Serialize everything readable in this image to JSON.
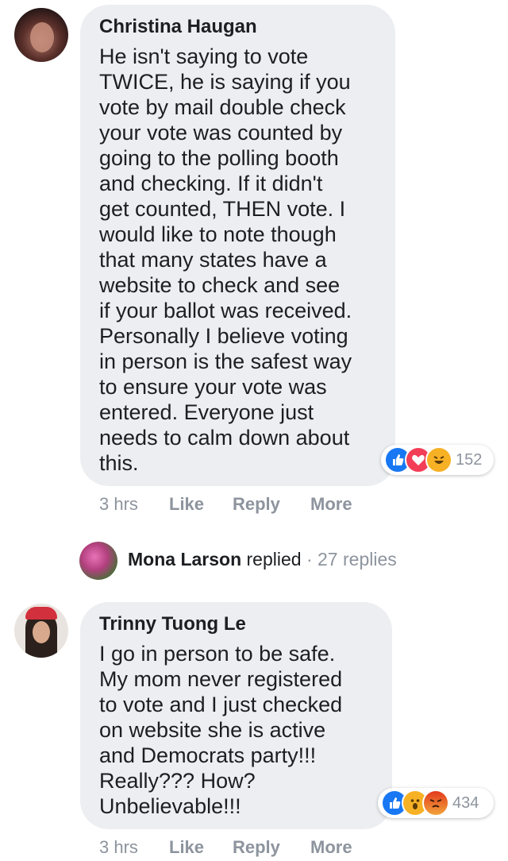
{
  "comments": [
    {
      "author": "Christina Haugan",
      "text": "He isn't saying to vote\nTWICE, he is saying if you\nvote by mail double check\nyour vote was counted by\ngoing to the polling booth\nand checking. If it didn't\nget counted, THEN vote. I\nwould like to note though\nthat many states have a\nwebsite to check and see\nif your ballot was received.\nPersonally I believe voting\nin person is the safest way\nto ensure your vote was\nentered. Everyone just\nneeds to calm down about\nthis.",
      "reaction_count": "152",
      "reaction_icons": [
        "like-icon",
        "love-icon",
        "haha-icon"
      ],
      "time": "3 hrs",
      "like_label": "Like",
      "reply_label": "Reply",
      "more_label": "More"
    },
    {
      "author": "Trinny Tuong Le",
      "text": "I go in person to be safe.\nMy mom never registered\nto vote and I just checked\non website she is active\nand Democrats party!!!\nReally??? How?\nUnbelievable!!!",
      "reaction_count": "434",
      "reaction_icons": [
        "like-icon",
        "wow-icon",
        "angry-icon"
      ],
      "time": "3 hrs",
      "like_label": "Like",
      "reply_label": "Reply",
      "more_label": "More"
    }
  ],
  "reply_summary": {
    "name": "Mona Larson",
    "action": "replied",
    "separator": "·",
    "count_text": "27 replies"
  },
  "colors": {
    "bubble": "#eceef1",
    "meta_gray": "#8d949e",
    "like_blue": "#1877f2",
    "love_red": "#f33e58",
    "haha_yellow": "#f7b125",
    "angry_orange": "#e9710f"
  }
}
